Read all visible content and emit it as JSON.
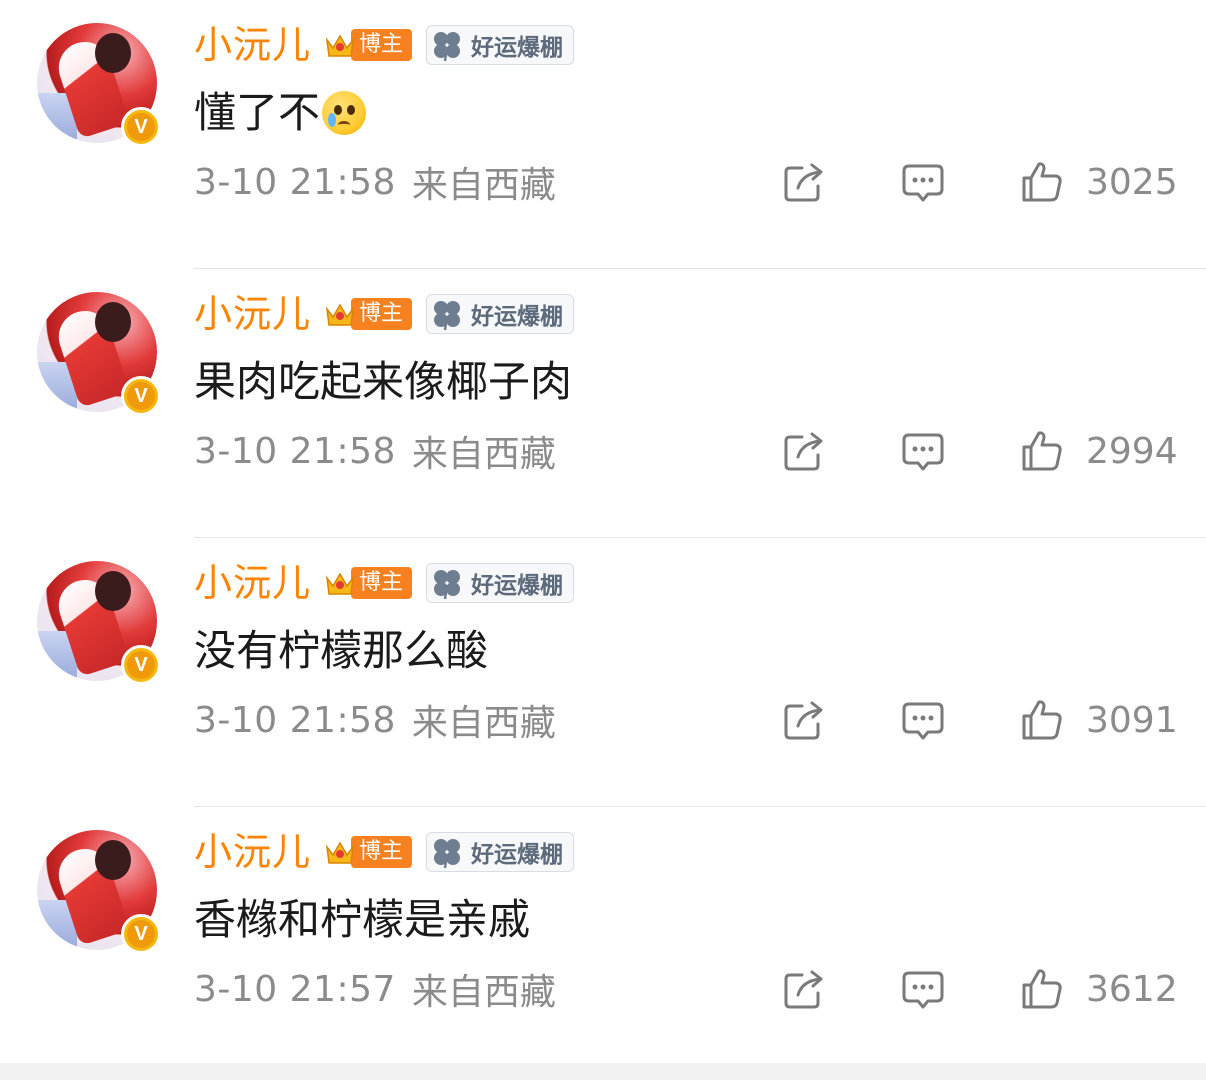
{
  "comments": [
    {
      "username": "小沅儿",
      "blogger_badge": "博主",
      "luck_badge": "好运爆棚",
      "text": "懂了不",
      "emoji": "crying-face-emoji",
      "time": "3-10 21:58",
      "location": "来自西藏",
      "likes": "3025"
    },
    {
      "username": "小沅儿",
      "blogger_badge": "博主",
      "luck_badge": "好运爆棚",
      "text": "果肉吃起来像椰子肉",
      "time": "3-10 21:58",
      "location": "来自西藏",
      "likes": "2994"
    },
    {
      "username": "小沅儿",
      "blogger_badge": "博主",
      "luck_badge": "好运爆棚",
      "text": "没有柠檬那么酸",
      "time": "3-10 21:58",
      "location": "来自西藏",
      "likes": "3091"
    },
    {
      "username": "小沅儿",
      "blogger_badge": "博主",
      "luck_badge": "好运爆棚",
      "text": "香橼和柠檬是亲戚",
      "time": "3-10 21:57",
      "location": "来自西藏",
      "likes": "3612"
    }
  ],
  "colors": {
    "username": "#ff8200",
    "blogger_badge_bg": "#f7801f",
    "meta_text": "#8b8b8b",
    "verified_badge": "#f6b80f"
  },
  "icons": {
    "share": "share-icon",
    "reply": "comment-icon",
    "like": "thumbs-up-icon",
    "verified": "verified-v-icon",
    "crown": "crown-icon",
    "clover": "clover-icon"
  }
}
